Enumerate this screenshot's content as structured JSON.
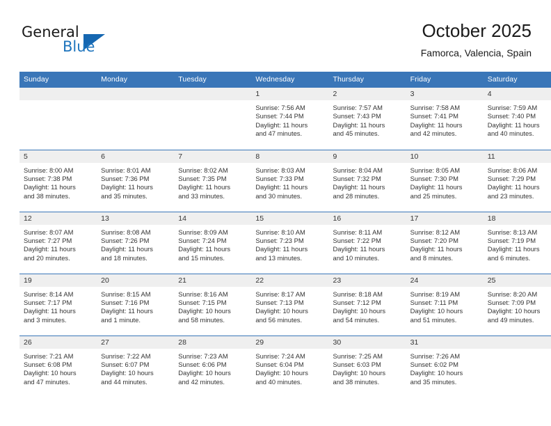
{
  "brand": {
    "name_part1": "General",
    "name_part2": "Blue",
    "triangle_color": "#1667b1",
    "blue_text_color": "#1d74bd",
    "icon": "triangle-logo-icon"
  },
  "header": {
    "title": "October 2025",
    "subtitle": "Famorca, Valencia, Spain"
  },
  "theme": {
    "header_blue": "#3a76b8",
    "daynum_band": "#efefef",
    "text": "#333333"
  },
  "weekdays": [
    "Sunday",
    "Monday",
    "Tuesday",
    "Wednesday",
    "Thursday",
    "Friday",
    "Saturday"
  ],
  "weeks": [
    [
      {
        "day": "",
        "sunrise": "",
        "sunset": "",
        "daylight1": "",
        "daylight2": ""
      },
      {
        "day": "",
        "sunrise": "",
        "sunset": "",
        "daylight1": "",
        "daylight2": ""
      },
      {
        "day": "",
        "sunrise": "",
        "sunset": "",
        "daylight1": "",
        "daylight2": ""
      },
      {
        "day": "1",
        "sunrise": "Sunrise: 7:56 AM",
        "sunset": "Sunset: 7:44 PM",
        "daylight1": "Daylight: 11 hours",
        "daylight2": "and 47 minutes."
      },
      {
        "day": "2",
        "sunrise": "Sunrise: 7:57 AM",
        "sunset": "Sunset: 7:43 PM",
        "daylight1": "Daylight: 11 hours",
        "daylight2": "and 45 minutes."
      },
      {
        "day": "3",
        "sunrise": "Sunrise: 7:58 AM",
        "sunset": "Sunset: 7:41 PM",
        "daylight1": "Daylight: 11 hours",
        "daylight2": "and 42 minutes."
      },
      {
        "day": "4",
        "sunrise": "Sunrise: 7:59 AM",
        "sunset": "Sunset: 7:40 PM",
        "daylight1": "Daylight: 11 hours",
        "daylight2": "and 40 minutes."
      }
    ],
    [
      {
        "day": "5",
        "sunrise": "Sunrise: 8:00 AM",
        "sunset": "Sunset: 7:38 PM",
        "daylight1": "Daylight: 11 hours",
        "daylight2": "and 38 minutes."
      },
      {
        "day": "6",
        "sunrise": "Sunrise: 8:01 AM",
        "sunset": "Sunset: 7:36 PM",
        "daylight1": "Daylight: 11 hours",
        "daylight2": "and 35 minutes."
      },
      {
        "day": "7",
        "sunrise": "Sunrise: 8:02 AM",
        "sunset": "Sunset: 7:35 PM",
        "daylight1": "Daylight: 11 hours",
        "daylight2": "and 33 minutes."
      },
      {
        "day": "8",
        "sunrise": "Sunrise: 8:03 AM",
        "sunset": "Sunset: 7:33 PM",
        "daylight1": "Daylight: 11 hours",
        "daylight2": "and 30 minutes."
      },
      {
        "day": "9",
        "sunrise": "Sunrise: 8:04 AM",
        "sunset": "Sunset: 7:32 PM",
        "daylight1": "Daylight: 11 hours",
        "daylight2": "and 28 minutes."
      },
      {
        "day": "10",
        "sunrise": "Sunrise: 8:05 AM",
        "sunset": "Sunset: 7:30 PM",
        "daylight1": "Daylight: 11 hours",
        "daylight2": "and 25 minutes."
      },
      {
        "day": "11",
        "sunrise": "Sunrise: 8:06 AM",
        "sunset": "Sunset: 7:29 PM",
        "daylight1": "Daylight: 11 hours",
        "daylight2": "and 23 minutes."
      }
    ],
    [
      {
        "day": "12",
        "sunrise": "Sunrise: 8:07 AM",
        "sunset": "Sunset: 7:27 PM",
        "daylight1": "Daylight: 11 hours",
        "daylight2": "and 20 minutes."
      },
      {
        "day": "13",
        "sunrise": "Sunrise: 8:08 AM",
        "sunset": "Sunset: 7:26 PM",
        "daylight1": "Daylight: 11 hours",
        "daylight2": "and 18 minutes."
      },
      {
        "day": "14",
        "sunrise": "Sunrise: 8:09 AM",
        "sunset": "Sunset: 7:24 PM",
        "daylight1": "Daylight: 11 hours",
        "daylight2": "and 15 minutes."
      },
      {
        "day": "15",
        "sunrise": "Sunrise: 8:10 AM",
        "sunset": "Sunset: 7:23 PM",
        "daylight1": "Daylight: 11 hours",
        "daylight2": "and 13 minutes."
      },
      {
        "day": "16",
        "sunrise": "Sunrise: 8:11 AM",
        "sunset": "Sunset: 7:22 PM",
        "daylight1": "Daylight: 11 hours",
        "daylight2": "and 10 minutes."
      },
      {
        "day": "17",
        "sunrise": "Sunrise: 8:12 AM",
        "sunset": "Sunset: 7:20 PM",
        "daylight1": "Daylight: 11 hours",
        "daylight2": "and 8 minutes."
      },
      {
        "day": "18",
        "sunrise": "Sunrise: 8:13 AM",
        "sunset": "Sunset: 7:19 PM",
        "daylight1": "Daylight: 11 hours",
        "daylight2": "and 6 minutes."
      }
    ],
    [
      {
        "day": "19",
        "sunrise": "Sunrise: 8:14 AM",
        "sunset": "Sunset: 7:17 PM",
        "daylight1": "Daylight: 11 hours",
        "daylight2": "and 3 minutes."
      },
      {
        "day": "20",
        "sunrise": "Sunrise: 8:15 AM",
        "sunset": "Sunset: 7:16 PM",
        "daylight1": "Daylight: 11 hours",
        "daylight2": "and 1 minute."
      },
      {
        "day": "21",
        "sunrise": "Sunrise: 8:16 AM",
        "sunset": "Sunset: 7:15 PM",
        "daylight1": "Daylight: 10 hours",
        "daylight2": "and 58 minutes."
      },
      {
        "day": "22",
        "sunrise": "Sunrise: 8:17 AM",
        "sunset": "Sunset: 7:13 PM",
        "daylight1": "Daylight: 10 hours",
        "daylight2": "and 56 minutes."
      },
      {
        "day": "23",
        "sunrise": "Sunrise: 8:18 AM",
        "sunset": "Sunset: 7:12 PM",
        "daylight1": "Daylight: 10 hours",
        "daylight2": "and 54 minutes."
      },
      {
        "day": "24",
        "sunrise": "Sunrise: 8:19 AM",
        "sunset": "Sunset: 7:11 PM",
        "daylight1": "Daylight: 10 hours",
        "daylight2": "and 51 minutes."
      },
      {
        "day": "25",
        "sunrise": "Sunrise: 8:20 AM",
        "sunset": "Sunset: 7:09 PM",
        "daylight1": "Daylight: 10 hours",
        "daylight2": "and 49 minutes."
      }
    ],
    [
      {
        "day": "26",
        "sunrise": "Sunrise: 7:21 AM",
        "sunset": "Sunset: 6:08 PM",
        "daylight1": "Daylight: 10 hours",
        "daylight2": "and 47 minutes."
      },
      {
        "day": "27",
        "sunrise": "Sunrise: 7:22 AM",
        "sunset": "Sunset: 6:07 PM",
        "daylight1": "Daylight: 10 hours",
        "daylight2": "and 44 minutes."
      },
      {
        "day": "28",
        "sunrise": "Sunrise: 7:23 AM",
        "sunset": "Sunset: 6:06 PM",
        "daylight1": "Daylight: 10 hours",
        "daylight2": "and 42 minutes."
      },
      {
        "day": "29",
        "sunrise": "Sunrise: 7:24 AM",
        "sunset": "Sunset: 6:04 PM",
        "daylight1": "Daylight: 10 hours",
        "daylight2": "and 40 minutes."
      },
      {
        "day": "30",
        "sunrise": "Sunrise: 7:25 AM",
        "sunset": "Sunset: 6:03 PM",
        "daylight1": "Daylight: 10 hours",
        "daylight2": "and 38 minutes."
      },
      {
        "day": "31",
        "sunrise": "Sunrise: 7:26 AM",
        "sunset": "Sunset: 6:02 PM",
        "daylight1": "Daylight: 10 hours",
        "daylight2": "and 35 minutes."
      },
      {
        "day": "",
        "sunrise": "",
        "sunset": "",
        "daylight1": "",
        "daylight2": ""
      }
    ]
  ]
}
